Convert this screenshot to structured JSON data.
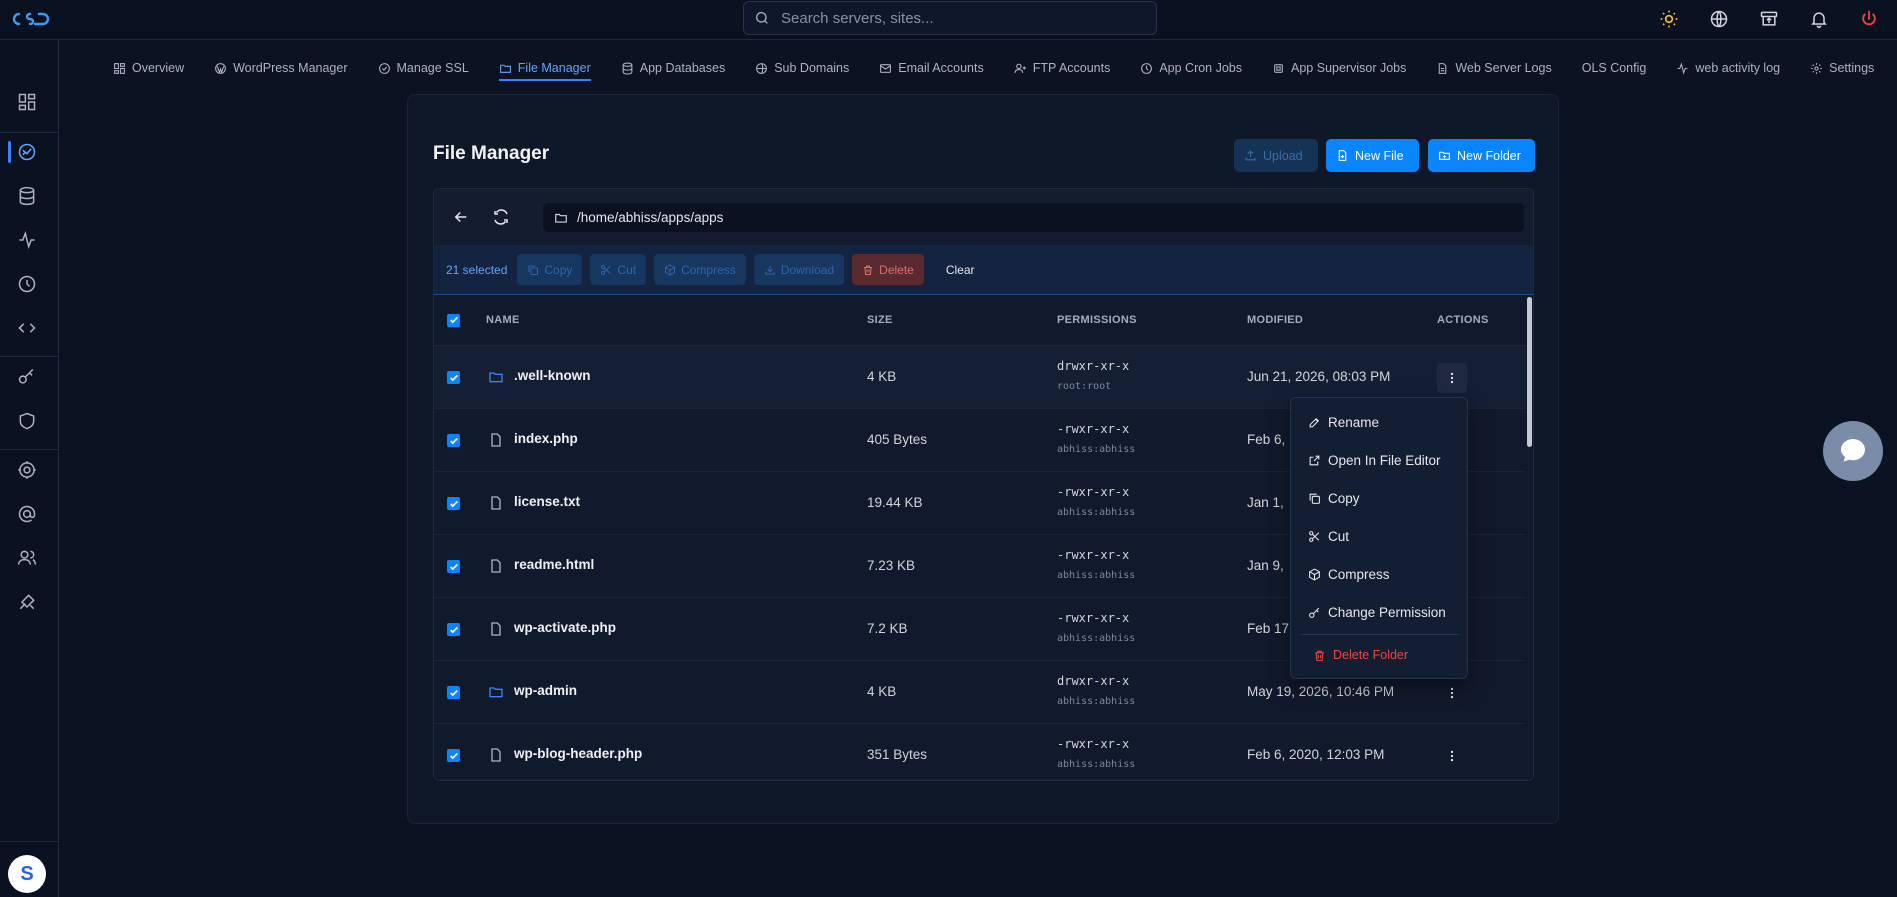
{
  "search": {
    "placeholder": "Search servers, sites..."
  },
  "nav": {
    "tabs": [
      {
        "label": "Overview",
        "icon": "grid-icon"
      },
      {
        "label": "WordPress Manager",
        "icon": "wordpress-icon"
      },
      {
        "label": "Manage SSL",
        "icon": "ssl-icon"
      },
      {
        "label": "File Manager",
        "icon": "folder-icon",
        "active": true
      },
      {
        "label": "App Databases",
        "icon": "database-icon"
      },
      {
        "label": "Sub Domains",
        "icon": "globe-icon"
      },
      {
        "label": "Email Accounts",
        "icon": "mail-icon"
      },
      {
        "label": "FTP Accounts",
        "icon": "user-plus-icon"
      },
      {
        "label": "App Cron Jobs",
        "icon": "clock-icon"
      },
      {
        "label": "App Supervisor Jobs",
        "icon": "cpu-icon"
      },
      {
        "label": "Web Server Logs",
        "icon": "file-icon"
      },
      {
        "label": "OLS Config",
        "icon": ""
      },
      {
        "label": "web activity log",
        "icon": "activity-icon"
      },
      {
        "label": "Settings",
        "icon": "gear-icon"
      }
    ]
  },
  "avatar": {
    "initial": "S"
  },
  "page": {
    "title": "File Manager",
    "upload_label": "Upload",
    "new_file_label": "New File",
    "new_folder_label": "New Folder"
  },
  "path": {
    "current": "/home/abhiss/apps/apps"
  },
  "selection": {
    "count_label": "21 selected",
    "copy_label": "Copy",
    "cut_label": "Cut",
    "compress_label": "Compress",
    "download_label": "Download",
    "delete_label": "Delete",
    "clear_label": "Clear"
  },
  "table": {
    "headers": {
      "name": "NAME",
      "size": "SIZE",
      "permissions": "PERMISSIONS",
      "modified": "MODIFIED",
      "actions": "ACTIONS"
    },
    "rows": [
      {
        "type": "folder",
        "name": ".well-known",
        "size": "4 KB",
        "perms": "drwxr-xr-x",
        "owner": "root:root",
        "modified": "Jun 21, 2026, 08:03 PM"
      },
      {
        "type": "file",
        "name": "index.php",
        "size": "405 Bytes",
        "perms": "-rwxr-xr-x",
        "owner": "abhiss:abhiss",
        "modified": "Feb 6,"
      },
      {
        "type": "file",
        "name": "license.txt",
        "size": "19.44 KB",
        "perms": "-rwxr-xr-x",
        "owner": "abhiss:abhiss",
        "modified": "Jan 1,"
      },
      {
        "type": "file",
        "name": "readme.html",
        "size": "7.23 KB",
        "perms": "-rwxr-xr-x",
        "owner": "abhiss:abhiss",
        "modified": "Jan 9,"
      },
      {
        "type": "file",
        "name": "wp-activate.php",
        "size": "7.2 KB",
        "perms": "-rwxr-xr-x",
        "owner": "abhiss:abhiss",
        "modified": "Feb 17"
      },
      {
        "type": "folder",
        "name": "wp-admin",
        "size": "4 KB",
        "perms": "drwxr-xr-x",
        "owner": "abhiss:abhiss",
        "modified": "May 19, 2026, 10:46 PM"
      },
      {
        "type": "file",
        "name": "wp-blog-header.php",
        "size": "351 Bytes",
        "perms": "-rwxr-xr-x",
        "owner": "abhiss:abhiss",
        "modified": "Feb 6, 2020, 12:03 PM"
      }
    ]
  },
  "context_menu": {
    "rename": "Rename",
    "open_editor": "Open In File Editor",
    "copy": "Copy",
    "cut": "Cut",
    "compress": "Compress",
    "change_permission": "Change Permission",
    "delete_folder": "Delete Folder"
  },
  "colors": {
    "accent": "#0a84ff",
    "danger": "#ef4444",
    "background": "#0b1221"
  }
}
